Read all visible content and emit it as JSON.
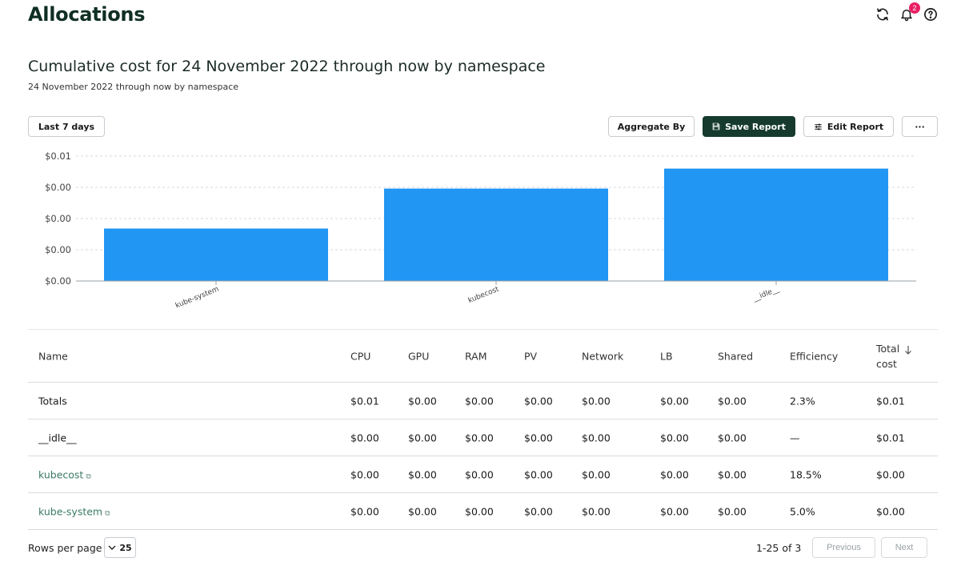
{
  "header": {
    "title": "Allocations",
    "notification_count": "2",
    "icons": [
      "refresh-icon",
      "bell-icon",
      "help-icon"
    ]
  },
  "report": {
    "title": "Cumulative cost for 24 November 2022 through now by namespace",
    "subtitle": "24 November 2022 through now by namespace"
  },
  "toolbar": {
    "date_range": "Last 7 days",
    "aggregate_by": "Aggregate By",
    "save_report": "Save Report",
    "edit_report": "Edit Report",
    "more": "···"
  },
  "colors": {
    "bar": "#2196f3",
    "accent_dark": "#163a2e",
    "link": "#3b7a62",
    "badge": "#e91e63"
  },
  "chart_data": {
    "type": "bar",
    "categories": [
      "kube-system",
      "kubecost",
      "__idle__"
    ],
    "values": [
      0.0042,
      0.0074,
      0.009
    ],
    "title": "",
    "xlabel": "",
    "ylabel": "",
    "ylim": [
      0,
      0.01
    ],
    "yticks": [
      "$0.00",
      "$0.00",
      "$0.00",
      "$0.00",
      "$0.01"
    ],
    "grid": true
  },
  "table": {
    "columns": [
      "Name",
      "CPU",
      "GPU",
      "RAM",
      "PV",
      "Network",
      "LB",
      "Shared",
      "Efficiency",
      "Total cost"
    ],
    "sort_icon": "arrow-down-icon",
    "rows": [
      {
        "name": "Totals",
        "link": false,
        "cells": [
          "$0.01",
          "$0.00",
          "$0.00",
          "$0.00",
          "$0.00",
          "$0.00",
          "$0.00",
          "2.3%",
          "$0.01"
        ]
      },
      {
        "name": "__idle__",
        "link": false,
        "cells": [
          "$0.00",
          "$0.00",
          "$0.00",
          "$0.00",
          "$0.00",
          "$0.00",
          "$0.00",
          "—",
          "$0.01"
        ]
      },
      {
        "name": "kubecost",
        "link": true,
        "cells": [
          "$0.00",
          "$0.00",
          "$0.00",
          "$0.00",
          "$0.00",
          "$0.00",
          "$0.00",
          "18.5%",
          "$0.00"
        ]
      },
      {
        "name": "kube-system",
        "link": true,
        "cells": [
          "$0.00",
          "$0.00",
          "$0.00",
          "$0.00",
          "$0.00",
          "$0.00",
          "$0.00",
          "5.0%",
          "$0.00"
        ]
      }
    ]
  },
  "pagination": {
    "rows_per_page_label": "Rows per page",
    "rows_per_page_value": "25",
    "range_label": "1-25 of 3",
    "previous": "Previous",
    "next": "Next"
  }
}
